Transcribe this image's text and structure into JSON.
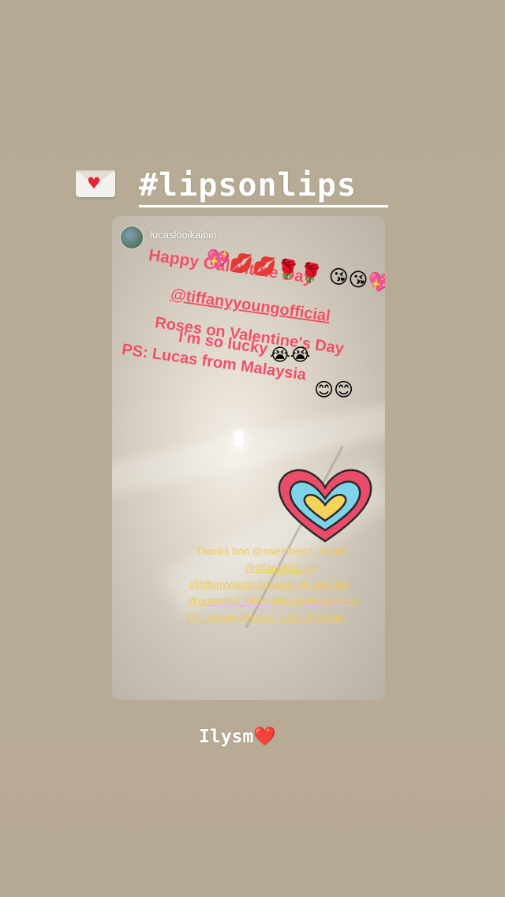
{
  "hashtag": "#lipsonlips",
  "card": {
    "username": "lucaslooikaibin",
    "line1": "Happy Galentine Day",
    "emoji_row1": "😘😘💖",
    "emoji_row2": "💖💋💋🌹🌹",
    "mention": "@tiffanyyoungofficial",
    "line3": "Roses on Valentine's Day",
    "line4": "I'm so lucky",
    "emoji_row3": "😭😭",
    "line5": "PS: Lucas from Malaysia",
    "emoji_row4": "😊😊",
    "thanks": [
      "Thanks bon @sweetheart_stephi",
      "@tiffany801_gg",
      "@tiffanyyoung.fanpage @_wei.han",
      "@guanghui_0610 @hyoyeontaeyeon",
      "@jj_lowww @yzlan_1116 @pertalo"
    ]
  },
  "caption": {
    "text": "Ilysm",
    "emoji": "❤️"
  },
  "colors": {
    "background": "#b8ab95",
    "message_red": "#ef5065",
    "thanks_yellow": "#f2c95a"
  }
}
